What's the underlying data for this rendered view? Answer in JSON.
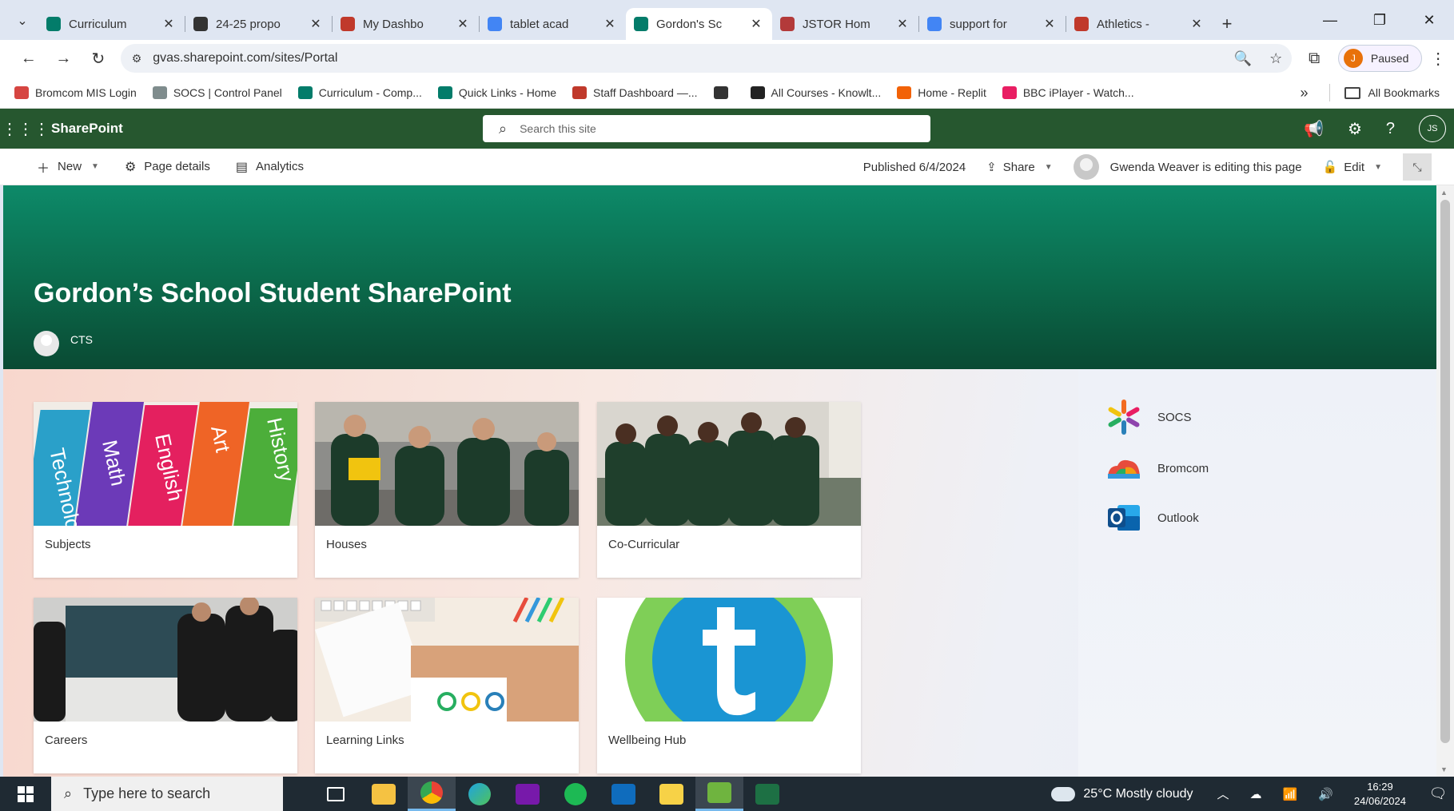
{
  "browser": {
    "tabs": [
      {
        "title": "Curriculum",
        "color": "#037c6a"
      },
      {
        "title": "24-25 propo",
        "color": "#333333"
      },
      {
        "title": "My Dashbo",
        "color": "#c0392b"
      },
      {
        "title": "tablet acad",
        "color": "#4285f4"
      },
      {
        "title": "Gordon's Sc",
        "color": "#037c6a"
      },
      {
        "title": "JSTOR Hom",
        "color": "#b33a3a"
      },
      {
        "title": "support for",
        "color": "#4285f4"
      },
      {
        "title": "Athletics -",
        "color": "#c0392b"
      }
    ],
    "active_tab_index": 4,
    "address": "gvas.sharepoint.com/sites/Portal",
    "profile_label": "Paused",
    "profile_initial": "J",
    "bookmarks": [
      {
        "label": "Bromcom MIS Login",
        "color": "#d64541"
      },
      {
        "label": "SOCS | Control Panel",
        "color": "#7f8c8d"
      },
      {
        "label": "Curriculum - Comp...",
        "color": "#037c6a"
      },
      {
        "label": "Quick Links - Home",
        "color": "#037c6a"
      },
      {
        "label": "Staff Dashboard —...",
        "color": "#c0392b"
      },
      {
        "label": "",
        "color": "#333333"
      },
      {
        "label": "All Courses - Knowlt...",
        "color": "#222222"
      },
      {
        "label": "Home - Replit",
        "color": "#f26207"
      },
      {
        "label": "BBC iPlayer - Watch...",
        "color": "#e91e63"
      }
    ],
    "all_bookmarks_label": "All Bookmarks"
  },
  "sharepoint": {
    "brand": "SharePoint",
    "search_placeholder": "Search this site",
    "user_initials": "JS",
    "commands": {
      "new": "New",
      "page_details": "Page details",
      "analytics": "Analytics",
      "published": "Published 6/4/2024",
      "share": "Share",
      "editing_notice": "Gwenda Weaver is editing this page",
      "edit": "Edit"
    },
    "hero": {
      "title": "Gordon’s School Student SharePoint",
      "author": "CTS"
    },
    "cards": [
      {
        "label": "Subjects"
      },
      {
        "label": "Houses"
      },
      {
        "label": "Co-Curricular"
      },
      {
        "label": "Careers"
      },
      {
        "label": "Learning Links"
      },
      {
        "label": "Wellbeing Hub"
      }
    ],
    "book_spines": [
      "Technolo",
      "Math",
      "English",
      "Art",
      "History"
    ],
    "quick_links": [
      {
        "label": "SOCS"
      },
      {
        "label": "Bromcom"
      },
      {
        "label": "Outlook"
      }
    ]
  },
  "taskbar": {
    "search_placeholder": "Type here to search",
    "weather": "25°C  Mostly cloudy",
    "time": "16:29",
    "date": "24/06/2024"
  }
}
